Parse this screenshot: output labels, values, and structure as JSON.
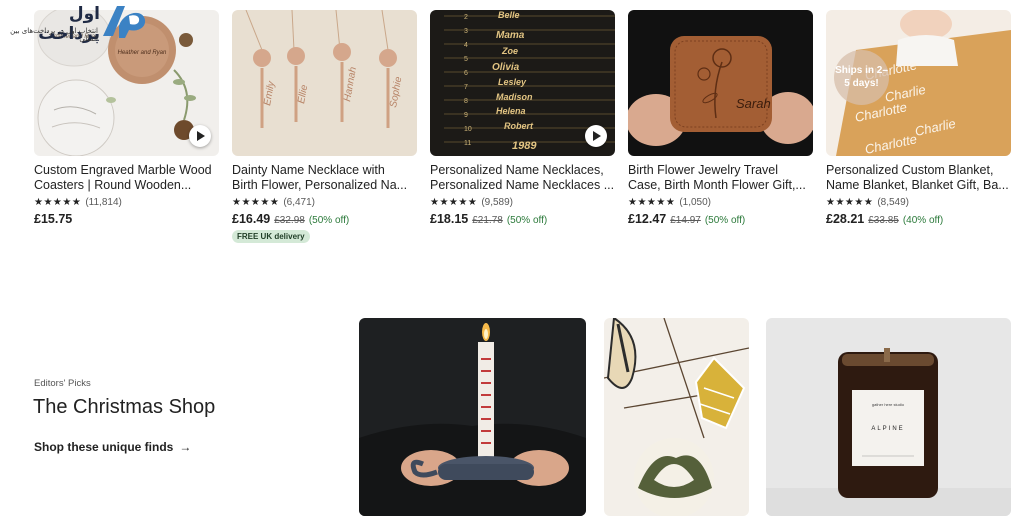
{
  "watermark": {
    "title": "اول پرداخت",
    "subtitle": "انتخاب اول در پرداخت‌های بین المللی"
  },
  "colors": {
    "sale_green": "#2c7a3b",
    "badge_bg": "#d4e9d7",
    "text": "#222222"
  },
  "products": [
    {
      "title_line1": "Custom Engraved Marble Wood",
      "title_line2": "Coasters | Round Wooden...",
      "stars": "★★★★★",
      "reviews": "(11,814)",
      "price": "£15.75",
      "original_price": "",
      "discount": "",
      "badge": "",
      "has_video": true
    },
    {
      "title_line1": "Dainty Name Necklace with",
      "title_line2": "Birth Flower, Personalized Na...",
      "stars": "★★★★★",
      "reviews": "(6,471)",
      "price": "£16.49",
      "original_price": "£32.98",
      "discount": "(50% off)",
      "badge": "FREE UK delivery",
      "has_video": false
    },
    {
      "title_line1": "Personalized Name Necklaces,",
      "title_line2": "Personalized Name Necklaces ...",
      "stars": "★★★★★",
      "reviews": "(9,589)",
      "price": "£18.15",
      "original_price": "£21.78",
      "discount": "(50% off)",
      "badge": "",
      "has_video": true
    },
    {
      "title_line1": "Birth Flower Jewelry Travel",
      "title_line2": "Case, Birth Month Flower Gift,...",
      "stars": "★★★★★",
      "reviews": "(1,050)",
      "price": "£12.47",
      "original_price": "£14.97",
      "discount": "(50% off)",
      "badge": "",
      "has_video": false
    },
    {
      "title_line1": "Personalized Custom Blanket,",
      "title_line2": "Name Blanket, Blanket Gift, Ba...",
      "stars": "★★★★★",
      "reviews": "(8,549)",
      "price": "£28.21",
      "original_price": "£33.85",
      "discount": "(40% off)",
      "badge": "",
      "has_video": false,
      "ships_badge": "Ships in 2–5 days!"
    }
  ],
  "image_text": {
    "coaster_names": [
      "Heather and Ryan",
      "Heather and Ryan"
    ],
    "necklace_names": [
      "Emily",
      "Ellie",
      "Hannah",
      "Sophie"
    ],
    "gold_names": [
      "Belle",
      "Mama",
      "Zoe",
      "Olivia",
      "Lesley",
      "Madison",
      "Helena",
      "Robert",
      "1989"
    ],
    "gold_numbers": [
      "2",
      "3",
      "4",
      "5",
      "6",
      "7",
      "8",
      "9",
      "10",
      "11"
    ],
    "case_name": "Sarah",
    "blanket_names": [
      "Charlotte",
      "Charlie",
      "Charlotte",
      "Charlie",
      "Charlotte"
    ],
    "candle_label_line1": "gather here studio",
    "candle_label_name": "ALPINE"
  },
  "editors_picks": {
    "label": "Editors' Picks",
    "title": "The Christmas Shop",
    "link": "Shop these unique finds",
    "arrow": "→"
  }
}
